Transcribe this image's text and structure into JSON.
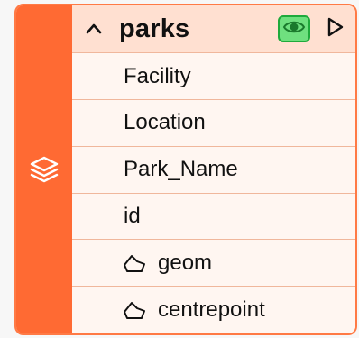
{
  "layer": {
    "title": "parks",
    "icons": {
      "collapse": "chevron-up-icon",
      "visibility": "eye-icon",
      "run": "play-icon",
      "layer": "layers-icon"
    },
    "colors": {
      "accent": "#ff6a33",
      "header_bg": "#ffe0d1",
      "row_bg": "#fff6f1",
      "eye_bg": "#6fe07f",
      "eye_border": "#1faa3c"
    },
    "fields": [
      {
        "label": "Facility",
        "icon": ""
      },
      {
        "label": "Location",
        "icon": ""
      },
      {
        "label": "Park_Name",
        "icon": ""
      },
      {
        "label": "id",
        "icon": ""
      },
      {
        "label": "geom",
        "icon": "polygon-icon"
      },
      {
        "label": "centrepoint",
        "icon": "polygon-icon"
      }
    ]
  }
}
